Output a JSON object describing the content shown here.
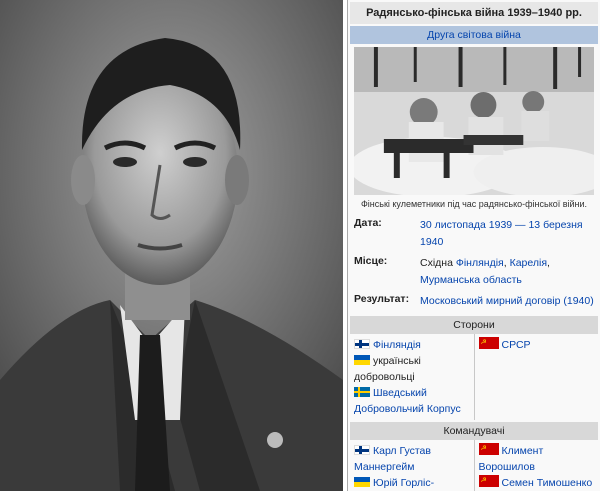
{
  "infobox": {
    "title": "Радянсько-фінська війна 1939–1940 рр.",
    "part_of": "Друга світова війна",
    "image_caption": "Фінські кулеметники під час радянсько-фінської війни.",
    "date": {
      "label": "Дата:",
      "value": "30 листопада 1939 — 13 березня 1940"
    },
    "place": {
      "label": "Місце:",
      "prefix": "Східна ",
      "link1": "Фінляндія",
      "sep": ", ",
      "link2": "Карелія",
      "sep2": ",",
      "link3": "Мурманська область"
    },
    "result": {
      "label": "Результат:",
      "value": "Московський мирний договір (1940)"
    },
    "sides": {
      "header": "Сторони",
      "left": [
        {
          "flag": "finland-flag",
          "text": "Фінляндія"
        },
        {
          "flag": "ukraine-flag",
          "text": "українські добровольці"
        },
        {
          "flag": "sweden-flag",
          "text": "Шведський Добровольчий Корпус"
        }
      ],
      "right": [
        {
          "flag": "ussr-flag",
          "text": "СРСР"
        }
      ]
    },
    "commanders": {
      "header": "Командувачі",
      "left": [
        {
          "flag": "finland-flag",
          "text": "Карл Густав Маннергейм"
        },
        {
          "flag": "ukraine-flag",
          "text": "Юрій Горліс-Горський"
        }
      ],
      "right": [
        {
          "flag": "ussr-flag",
          "text": "Климент Ворошилов"
        },
        {
          "flag": "ussr-flag",
          "text": "Семен Тимошенко"
        }
      ]
    }
  },
  "colors": {
    "link": "#0645ad",
    "header_bg": "#d8d8d8",
    "part_bg": "#b0c4de"
  }
}
